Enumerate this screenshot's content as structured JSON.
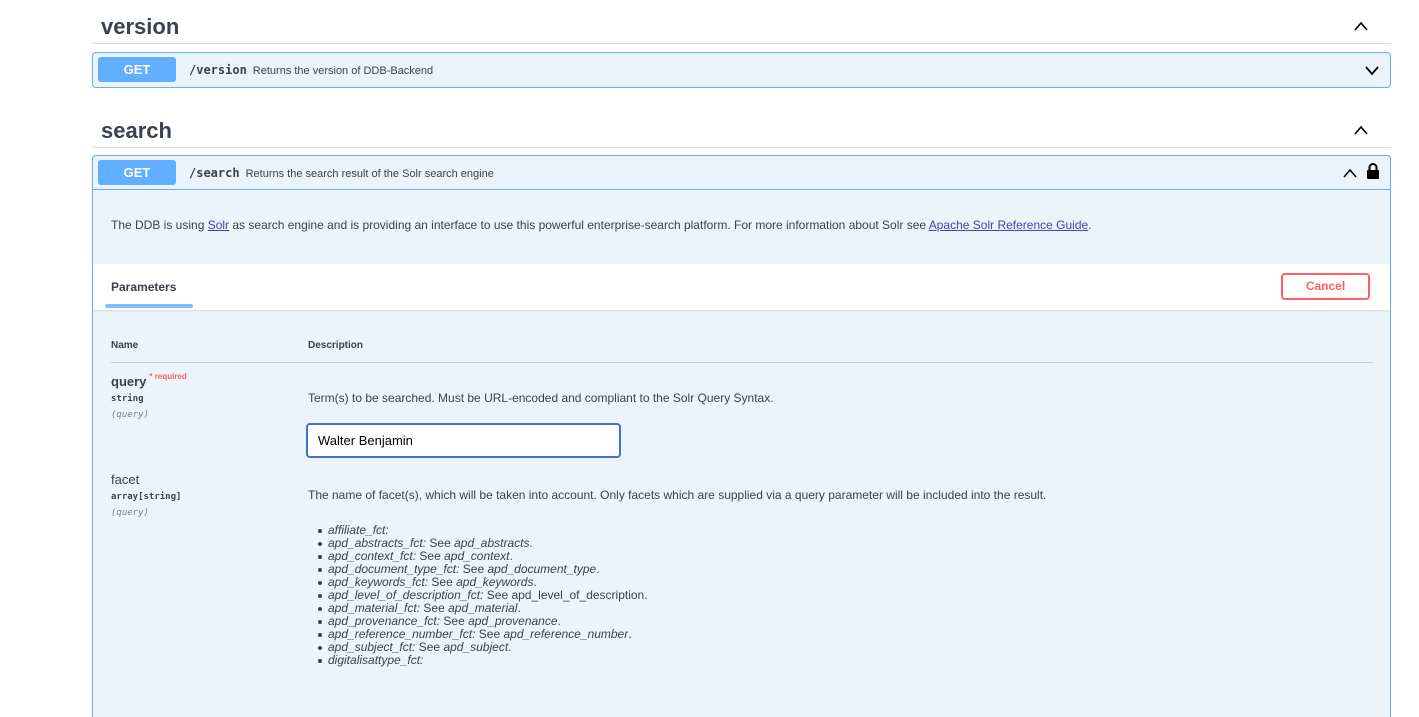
{
  "sections": [
    {
      "title": "version"
    },
    {
      "title": "search"
    }
  ],
  "version_op": {
    "method": "GET",
    "path": "/version",
    "summary": "Returns the version of DDB-Backend"
  },
  "search_op": {
    "method": "GET",
    "path": "/search",
    "summary": "Returns the search result of the Solr search engine",
    "description": {
      "part1": "The DDB is using ",
      "link1": "Solr",
      "part2": " as search engine and is providing an interface to use this powerful enterprise-search platform. For more information about Solr see ",
      "link2": "Apache Solr Reference Guide",
      "part3": "."
    },
    "parameters_tab": "Parameters",
    "cancel_label": "Cancel",
    "col_name": "Name",
    "col_description": "Description",
    "params": [
      {
        "name": "query",
        "required_mark": "*",
        "required_label": "required",
        "type": "string",
        "in": "(query)",
        "description": "Term(s) to be searched. Must be URL-encoded and compliant to the Solr Query Syntax.",
        "value": "Walter Benjamin"
      },
      {
        "name": "facet",
        "type": "array[string]",
        "in": "(query)",
        "description": "The name of facet(s), which will be taken into account. Only facets which are supplied via a query parameter will be included into the result.",
        "items": [
          {
            "key": "affiliate_fct:",
            "see": "",
            "ref": "",
            "end": ""
          },
          {
            "key": "apd_abstracts_fct:",
            "see": " See ",
            "ref": "apd_abstracts",
            "end": "."
          },
          {
            "key": "apd_context_fct:",
            "see": " See ",
            "ref": "apd_context",
            "end": "."
          },
          {
            "key": "apd_document_type_fct:",
            "see": " See ",
            "ref": "apd_document_type",
            "end": "."
          },
          {
            "key": "apd_keywords_fct:",
            "see": " See ",
            "ref": "apd_keywords",
            "end": "."
          },
          {
            "key": "apd_level_of_description_fct:",
            "see": " See apd_level_of_description.",
            "ref": "",
            "end": ""
          },
          {
            "key": "apd_material_fct:",
            "see": " See ",
            "ref": "apd_material",
            "end": "."
          },
          {
            "key": "apd_provenance_fct:",
            "see": " See ",
            "ref": "apd_provenance",
            "end": "."
          },
          {
            "key": "apd_reference_number_fct:",
            "see": " See ",
            "ref": "apd_reference_number",
            "end": "."
          },
          {
            "key": "apd_subject_fct:",
            "see": " See ",
            "ref": "apd_subject",
            "end": "."
          },
          {
            "key": "digitalisattype_fct:",
            "see": "",
            "ref": "",
            "end": ""
          }
        ]
      }
    ]
  },
  "colors": {
    "get_blue": "#61affe",
    "op_bg": "#ebf3fb",
    "cancel_red": "#ff6060",
    "text": "#3b4151"
  }
}
